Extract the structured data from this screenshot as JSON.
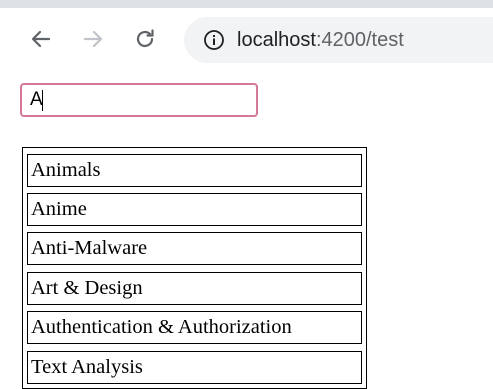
{
  "browser": {
    "url_host": "localhost",
    "url_rest": ":4200/test",
    "icons": [
      "back-arrow-icon",
      "forward-arrow-icon",
      "reload-icon",
      "info-icon"
    ],
    "colors": {
      "icon_active": "#5f6368",
      "icon_disabled": "#c0c3c7",
      "omnibox_bg": "#f1f3f4"
    }
  },
  "search": {
    "value": "A",
    "border_color": "#d6789a"
  },
  "results": [
    {
      "label": "Animals"
    },
    {
      "label": "Anime"
    },
    {
      "label": "Anti-Malware"
    },
    {
      "label": "Art & Design"
    },
    {
      "label": "Authentication & Authorization"
    },
    {
      "label": "Text Analysis"
    }
  ]
}
